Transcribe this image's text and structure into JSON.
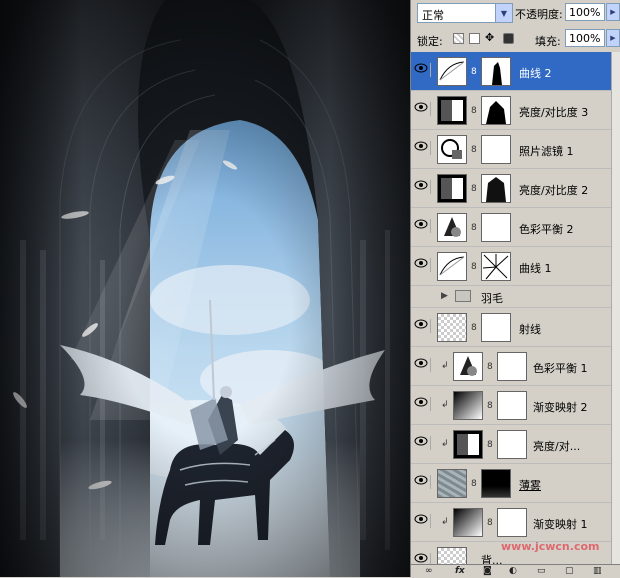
{
  "panel": {
    "blend_mode": "正常",
    "opacity_label": "不透明度:",
    "opacity_value": "100%",
    "lock_label": "锁定:",
    "fill_label": "填充:",
    "fill_value": "100%"
  },
  "layers": [
    {
      "name": "曲线 2",
      "selected": true,
      "icon": "curves-icon"
    },
    {
      "name": "亮度/对比度 3",
      "selected": false,
      "icon": "brightness-contrast-icon"
    },
    {
      "name": "照片滤镜 1",
      "selected": false,
      "icon": "photo-filter-icon"
    },
    {
      "name": "亮度/对比度 2",
      "selected": false,
      "icon": "brightness-contrast-icon"
    },
    {
      "name": "色彩平衡 2",
      "selected": false,
      "icon": "color-balance-icon"
    },
    {
      "name": "曲线 1",
      "selected": false,
      "icon": "curves-icon"
    },
    {
      "name": "羽毛",
      "group": true,
      "icon": "folder-icon"
    },
    {
      "name": "射线",
      "selected": false,
      "icon": "transparent-thumb"
    },
    {
      "name": "色彩平衡 1",
      "selected": false,
      "clipped": true,
      "icon": "color-balance-icon"
    },
    {
      "name": "渐变映射 2",
      "selected": false,
      "clipped": true,
      "icon": "gradient-map-icon"
    },
    {
      "name": "亮度/对...",
      "selected": false,
      "clipped": true,
      "icon": "brightness-contrast-icon"
    },
    {
      "name": "薄雾",
      "selected": false,
      "icon": "texture-thumb"
    },
    {
      "name": "渐变映射 1",
      "selected": false,
      "clipped": true,
      "icon": "gradient-map-icon"
    },
    {
      "name": "背...",
      "selected": false,
      "icon": "transparent-thumb"
    }
  ],
  "watermark": "www.jcwcn.com",
  "bottom_icons": [
    "link-icon",
    "fx-icon",
    "mask-icon",
    "adjustment-icon",
    "group-icon",
    "new-layer-icon",
    "trash-icon"
  ]
}
